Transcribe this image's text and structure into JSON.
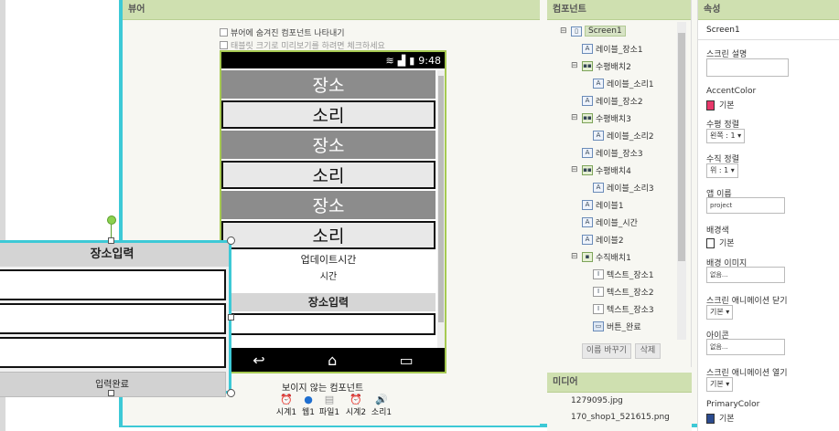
{
  "viewer": {
    "title": "뷰어",
    "show_hidden_label": "뷰어에 숨겨진 컴포넌트 나타내기",
    "tablet_preview_label": "태블릿 크기로 미리보기를 하려면 체크하세요"
  },
  "phone": {
    "time": "9:48",
    "rows": [
      "장소",
      "소리",
      "장소",
      "소리",
      "장소",
      "소리"
    ],
    "update_time_label": "업데이트시간",
    "time_label": "시간",
    "place_input_header": "장소입력"
  },
  "non_visible": {
    "title": "보이지 않는 컴포넌트",
    "items": [
      {
        "label": "시계1",
        "icon": "clock-icon"
      },
      {
        "label": "웹1",
        "icon": "web-icon"
      },
      {
        "label": "파일1",
        "icon": "file-icon"
      },
      {
        "label": "시계2",
        "icon": "clock-icon"
      },
      {
        "label": "소리1",
        "icon": "sound-icon"
      }
    ]
  },
  "dialog": {
    "title": "장소입력",
    "submit_label": "입력완료"
  },
  "components": {
    "title": "컴포넌트",
    "tree": [
      {
        "label": "Screen1",
        "toggle": "⊟",
        "icon": "screen-icon",
        "selected": true
      },
      {
        "label": "레이블_장소1",
        "icon": "label-icon"
      },
      {
        "label": "수평배치2",
        "toggle": "⊟",
        "icon": "horizontal-arrangement-icon"
      },
      {
        "label": "레이블_소리1",
        "icon": "label-icon"
      },
      {
        "label": "레이블_장소2",
        "icon": "label-icon"
      },
      {
        "label": "수평배치3",
        "toggle": "⊟",
        "icon": "horizontal-arrangement-icon"
      },
      {
        "label": "레이블_소리2",
        "icon": "label-icon"
      },
      {
        "label": "레이블_장소3",
        "icon": "label-icon"
      },
      {
        "label": "수평배치4",
        "toggle": "⊟",
        "icon": "horizontal-arrangement-icon"
      },
      {
        "label": "레이블_소리3",
        "icon": "label-icon"
      },
      {
        "label": "레이블1",
        "icon": "label-icon"
      },
      {
        "label": "레이블_시간",
        "icon": "label-icon"
      },
      {
        "label": "레이블2",
        "icon": "label-icon"
      },
      {
        "label": "수직배치1",
        "toggle": "⊟",
        "icon": "vertical-arrangement-icon"
      },
      {
        "label": "텍스트_장소1",
        "icon": "textbox-icon"
      },
      {
        "label": "텍스트_장소2",
        "icon": "textbox-icon"
      },
      {
        "label": "텍스트_장소3",
        "icon": "textbox-icon"
      },
      {
        "label": "버튼_완료",
        "icon": "button-icon"
      }
    ],
    "rename_button": "이름 바꾸기",
    "delete_button": "삭제"
  },
  "media": {
    "title": "미디어",
    "files": [
      "1279095.jpg",
      "170_shop1_521615.png"
    ]
  },
  "properties": {
    "title": "속성",
    "component_name": "Screen1",
    "about_screen_label": "스크린 설명",
    "accent_color_label": "AccentColor",
    "accent_color_value": "기본",
    "accent_color": "#e8386a",
    "align_horizontal_label": "수평 정렬",
    "align_horizontal_value": "왼쪽 : 1 ▾",
    "align_vertical_label": "수직 정렬",
    "align_vertical_value": "위 : 1 ▾",
    "app_name_label": "앱 이름",
    "app_name_value": "project",
    "background_color_label": "배경색",
    "background_color_value": "기본",
    "background_color": "#ffffff",
    "background_image_label": "배경 이미지",
    "background_image_value": "없음...",
    "close_animation_label": "스크린 애니메이션 닫기",
    "close_animation_value": "기본 ▾",
    "icon_label": "아이콘",
    "icon_value": "없음...",
    "open_animation_label": "스크린 애니메이션 열기",
    "open_animation_value": "기본 ▾",
    "primary_color_label": "PrimaryColor",
    "primary_color_value": "기본",
    "primary_color": "#2b4b8f"
  },
  "colors": {
    "frame": "#3dc9d6",
    "header": "#cfe0b0",
    "phone_border": "#a6c952"
  }
}
